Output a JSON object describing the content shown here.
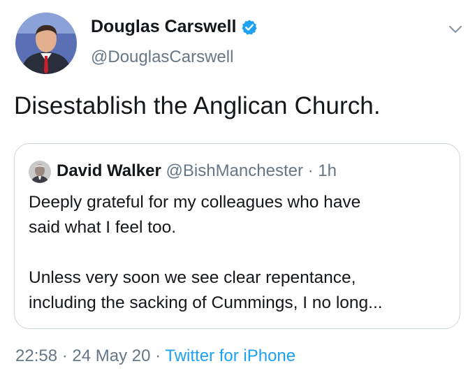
{
  "tweet": {
    "author": {
      "name": "Douglas Carswell",
      "handle": "@DouglasCarswell",
      "verified": true,
      "avatar_icon": "avatar-photo-icon"
    },
    "text": "Disestablish the Anglican Church.",
    "quoted_tweet": {
      "author_name": "David Walker",
      "author_handle": "@BishManchester",
      "separator": " · ",
      "age": "1h",
      "body_lines": [
        "Deeply grateful for my colleagues who have",
        "said what I feel too.",
        "",
        "Unless very soon we see clear repentance,",
        "including the sacking of Cummings, I no long..."
      ]
    },
    "meta": {
      "time": "22:58",
      "separator": " · ",
      "date": "24 May 20",
      "source": "Twitter for iPhone"
    }
  },
  "colors": {
    "text": "#14171a",
    "secondary": "#657786",
    "link": "#1da1f2",
    "verified_badge": "#1da1f2",
    "border": "#ccd6dd"
  },
  "icons": {
    "verified": "verified-badge-icon",
    "menu": "chevron-down-icon"
  }
}
